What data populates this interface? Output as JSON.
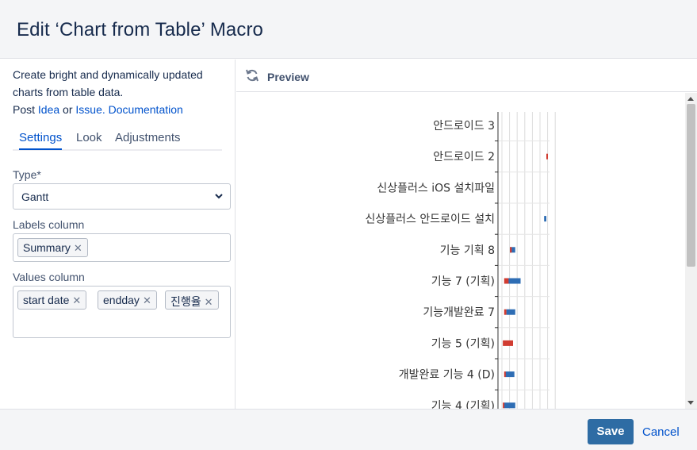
{
  "dialog": {
    "title": "Edit ‘Chart from Table’ Macro"
  },
  "left": {
    "description_line1": "Create bright and dynamically updated",
    "description_line2": "charts from table data.",
    "post_label": "Post",
    "idea_link": "Idea",
    "or_label": "or",
    "issue_link": "Issue.",
    "documentation_link": "Documentation",
    "tabs": [
      {
        "label": "Settings",
        "active": true
      },
      {
        "label": "Look",
        "active": false
      },
      {
        "label": "Adjustments",
        "active": false
      }
    ],
    "type_label": "Type*",
    "type_value": "Gantt",
    "labels_column_label": "Labels column",
    "labels_tags": [
      "Summary"
    ],
    "values_column_label": "Values column",
    "values_tags": [
      "start date",
      "endday",
      "진행율"
    ]
  },
  "preview": {
    "label": "Preview"
  },
  "chart_data": {
    "type": "gantt",
    "categories": [
      "안드로이드 3",
      "안드로이드 2",
      "신상플러스 iOS 설치파일",
      "신상플러스 안드로이드 설치",
      "기능 기획 8",
      "기능 7 (기획)",
      "기능개발완료 7",
      "기능 5 (기획)",
      "개발완료 기능 4 (D)",
      "기능 4 (기획)"
    ],
    "series": [
      {
        "name": "",
        "color": "#2e6db4",
        "values": [
          null,
          null,
          null,
          [
            0.95,
            1.0
          ],
          [
            0.18,
            0.3
          ],
          [
            0.12,
            0.42
          ],
          [
            0.1,
            0.3
          ],
          null,
          [
            0.08,
            0.28
          ],
          [
            0.05,
            0.3
          ]
        ]
      },
      {
        "name": "",
        "color": "#d13d32",
        "values": [
          null,
          [
            1.0,
            1.03
          ],
          null,
          null,
          [
            0.18,
            0.22
          ],
          [
            0.05,
            0.15
          ],
          [
            0.05,
            0.1
          ],
          [
            0.02,
            0.25
          ],
          [
            0.05,
            0.08
          ],
          [
            0.02,
            0.05
          ]
        ]
      }
    ],
    "grid": true
  },
  "footer": {
    "save_label": "Save",
    "cancel_label": "Cancel"
  },
  "colors": {
    "accent": "#0052cc",
    "save_bg": "#2e6ca4",
    "bar_blue": "#2e6db4",
    "bar_red": "#d13d32"
  }
}
